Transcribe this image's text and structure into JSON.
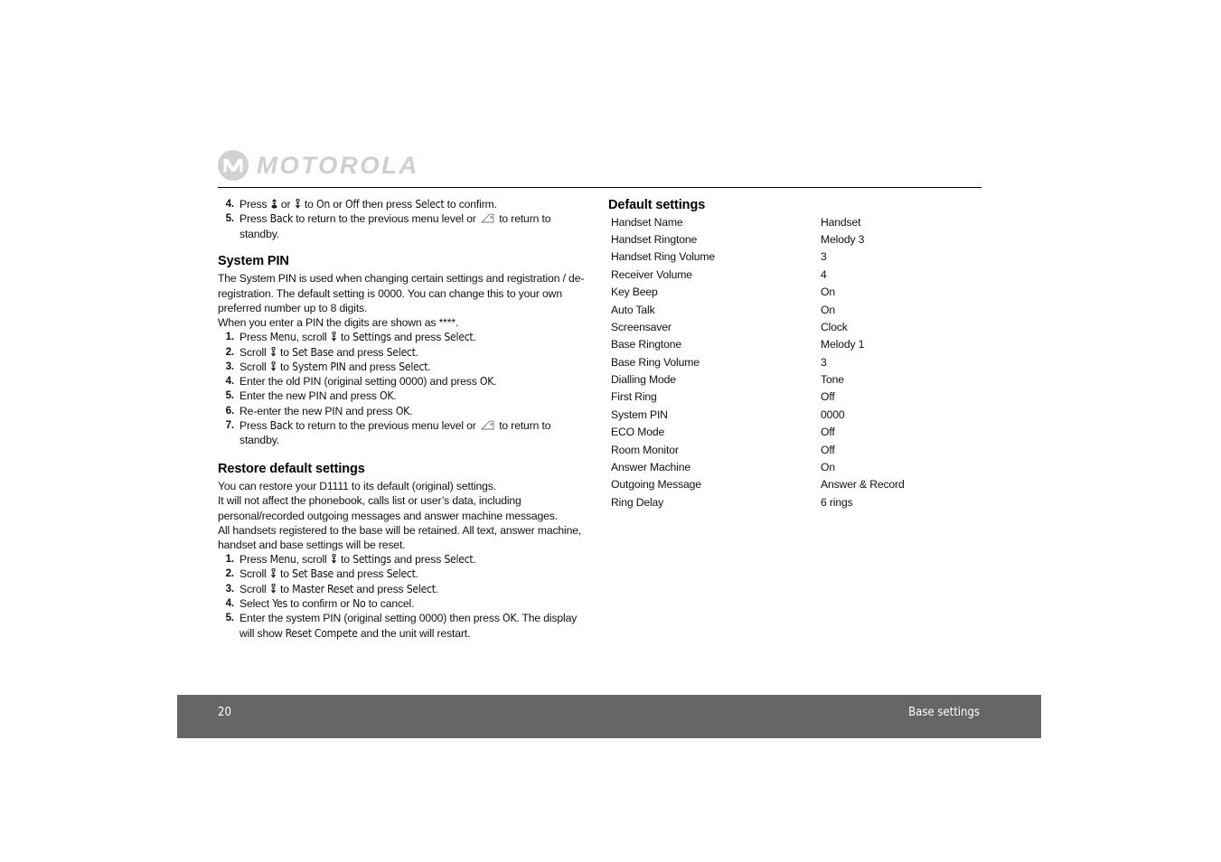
{
  "brand": {
    "logo_text": "MOTOROLA",
    "logo_icon": "motorola-m-logo",
    "logo_color": "#cfcfcf"
  },
  "footer": {
    "page_number": "20",
    "section": "Base settings",
    "background_color": "#666666",
    "text_color": "#ffffff"
  },
  "left_column": {
    "continued_steps": {
      "start_number": 4,
      "items": [
        {
          "prefix": "Press ",
          "icon_up": "scroll-up-key-icon",
          "mid1": " or ",
          "icon_down": "scroll-down-key-icon",
          "mid2": " to ",
          "ui1": "On",
          "mid3": " or ",
          "ui2": "Off",
          "mid4": " then press ",
          "ui3": "Select",
          "suffix": " to confirm."
        },
        {
          "prefix": "Press ",
          "ui1": "Back",
          "mid1": " to return to the previous menu level or ",
          "icon_end": "end-call-key-icon",
          "suffix": " to return to standby."
        }
      ]
    },
    "system_pin": {
      "heading": "System PIN",
      "paragraph_1": "The System PIN is used when changing certain settings and registration / de-registration. The default setting is 0000. You can change this to your own preferred number up to 8 digits.",
      "paragraph_2": "When you enter a PIN the digits are shown as ****.",
      "steps": [
        {
          "prefix": "Press ",
          "ui1": "Menu",
          "mid1": ", scroll ",
          "icon_down": "scroll-down-key-icon",
          "mid2": " to ",
          "ui2": "Settings",
          "mid3": " and press ",
          "ui3": "Select",
          "suffix": "."
        },
        {
          "prefix": "Scroll ",
          "icon_down": "scroll-down-key-icon",
          "mid2": " to ",
          "ui2": "Set Base",
          "mid3": " and press ",
          "ui3": "Select",
          "suffix": "."
        },
        {
          "prefix": "Scroll ",
          "icon_down": "scroll-down-key-icon",
          "mid2": " to ",
          "ui2": "System PIN",
          "mid3": " and press ",
          "ui3": "Select",
          "suffix": "."
        },
        {
          "prefix": "Enter the old PIN (original setting 0000) and press ",
          "ui1": "OK",
          "suffix": "."
        },
        {
          "prefix": "Enter the new PIN and press ",
          "ui1": "OK",
          "suffix": "."
        },
        {
          "prefix": "Re-enter the new PIN and press ",
          "ui1": "OK",
          "suffix": "."
        },
        {
          "prefix": "Press ",
          "ui1": "Back",
          "mid1": " to return to the previous menu level or ",
          "icon_end": "end-call-key-icon",
          "suffix": " to return to standby."
        }
      ]
    },
    "restore_defaults": {
      "heading": "Restore default settings",
      "paragraph_1": "You can restore your D1111 to its default (original) settings. It will not affect the phonebook, calls list or user’s data, including personal/recorded outgoing messages and answer machine messages.",
      "paragraph_1_line1": "You can restore your D1111 to its default (original) settings.",
      "paragraph_1_line2": "It will not affect the phonebook, calls list or user’s data, including personal/recorded outgoing messages and answer machine messages.",
      "paragraph_2": "All handsets registered to the base will be retained. All text, answer machine, handset and base settings will be reset.",
      "steps": [
        {
          "prefix": "Press ",
          "ui1": "Menu",
          "mid1": ", scroll ",
          "icon_down": "scroll-down-key-icon",
          "mid2": " to ",
          "ui2": "Settings",
          "mid3": " and press ",
          "ui3": "Select",
          "suffix": "."
        },
        {
          "prefix": "Scroll ",
          "icon_down": "scroll-down-key-icon",
          "mid2": " to ",
          "ui2": "Set Base",
          "mid3": " and press ",
          "ui3": "Select",
          "suffix": "."
        },
        {
          "prefix": "Scroll ",
          "icon_down": "scroll-down-key-icon",
          "mid2": " to ",
          "ui2": "Master Reset",
          "mid3": " and press ",
          "ui3": "Select",
          "suffix": "."
        },
        {
          "prefix": "Select ",
          "ui1": "Yes",
          "mid1": " to confirm or ",
          "ui2": "No",
          "suffix": " to cancel."
        },
        {
          "prefix": "Enter the system PIN (original setting 0000) then press ",
          "ui1": "OK",
          "mid1": ". The display will show ",
          "ui2": "Reset Compete",
          "suffix": " and the unit will restart."
        }
      ]
    }
  },
  "right_column": {
    "heading": "Default settings",
    "rows": [
      {
        "label": "Handset Name",
        "value": "Handset"
      },
      {
        "label": "Handset Ringtone",
        "value": "Melody 3"
      },
      {
        "label": "Handset Ring Volume",
        "value": "3"
      },
      {
        "label": "Receiver Volume",
        "value": "4"
      },
      {
        "label": "Key Beep",
        "value": "On"
      },
      {
        "label": "Auto Talk",
        "value": "On"
      },
      {
        "label": "Screensaver",
        "value": "Clock"
      },
      {
        "label": "Base Ringtone",
        "value": "Melody 1"
      },
      {
        "label": "Base Ring Volume",
        "value": "3"
      },
      {
        "label": "Dialling Mode",
        "value": "Tone"
      },
      {
        "label": "First Ring",
        "value": "Off"
      },
      {
        "label": "System PIN",
        "value": "0000"
      },
      {
        "label": "ECO Mode",
        "value": "Off"
      },
      {
        "label": "Room Monitor",
        "value": "Off"
      },
      {
        "label": "Answer Machine",
        "value": "On"
      },
      {
        "label": "Outgoing Message",
        "value": "Answer & Record"
      },
      {
        "label": "Ring Delay",
        "value": "6 rings"
      }
    ]
  }
}
